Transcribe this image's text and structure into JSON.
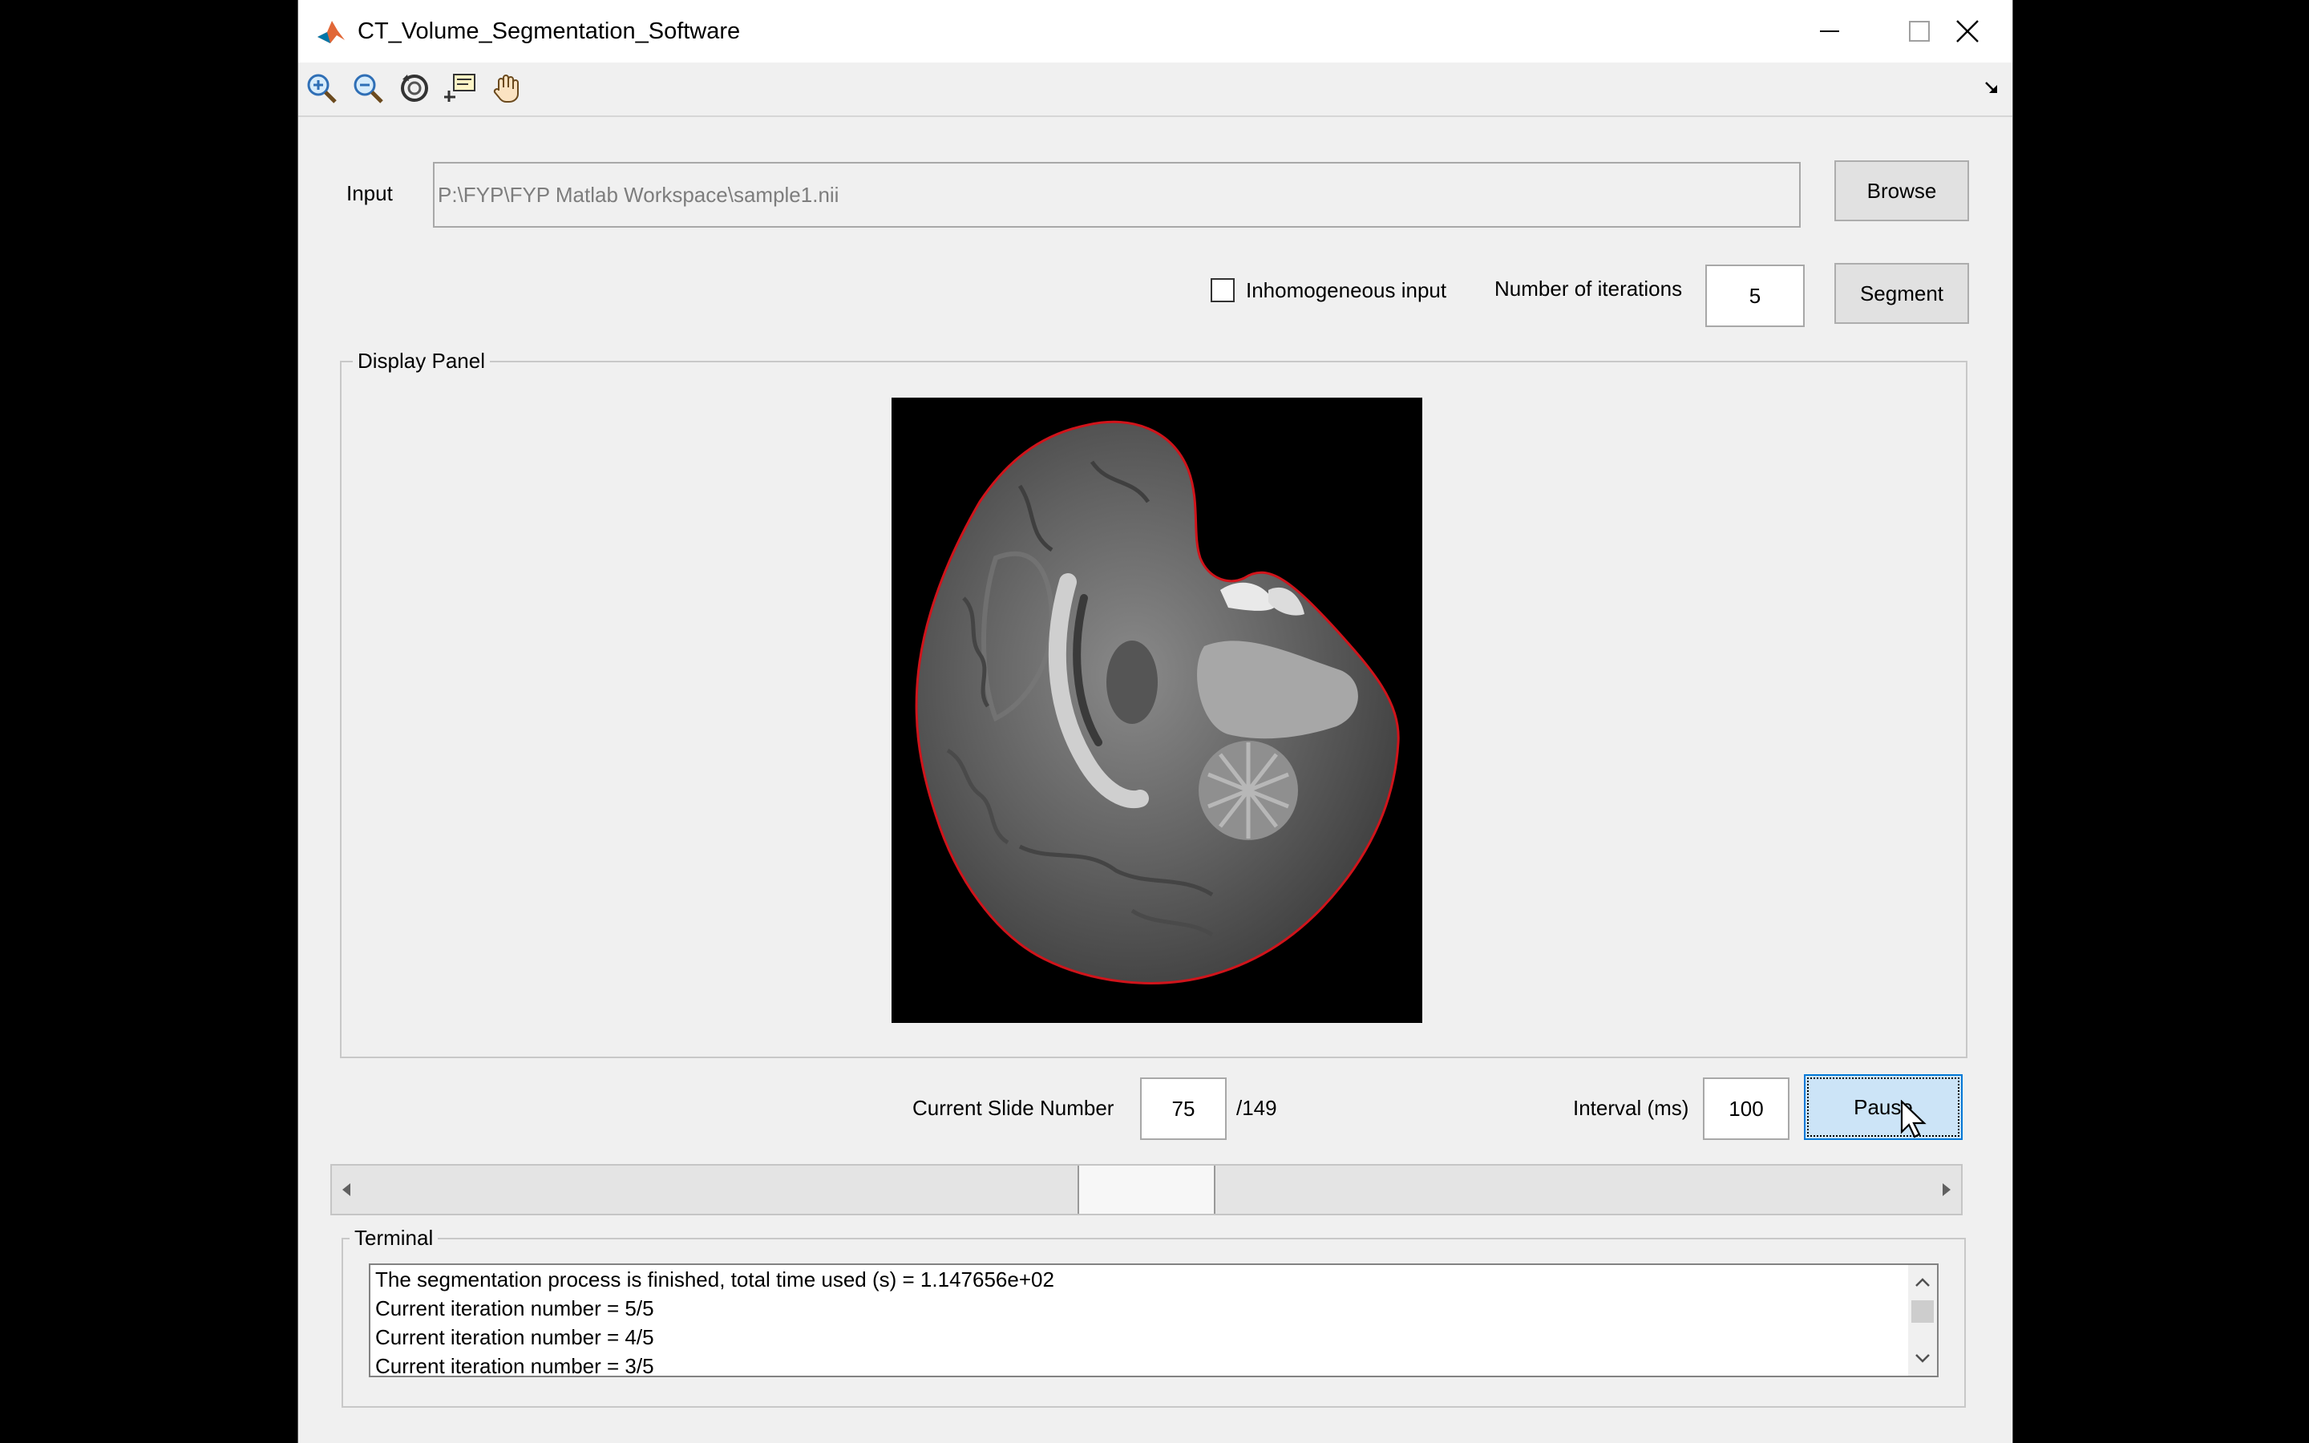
{
  "window": {
    "title": "CT_Volume_Segmentation_Software",
    "icon": "matlab-icon",
    "controls": [
      "minimize-icon",
      "maximize-icon",
      "close-icon"
    ]
  },
  "toolbar": {
    "tools": [
      "zoom-in-icon",
      "zoom-out-icon",
      "rotate-3d-icon",
      "data-cursor-icon",
      "pan-hand-icon"
    ]
  },
  "input": {
    "label": "Input",
    "path": "P:\\FYP\\FYP Matlab Workspace\\sample1.nii",
    "browse_label": "Browse"
  },
  "options": {
    "inhomogeneous_label": "Inhomogeneous input",
    "inhomogeneous_checked": false,
    "iterations_label": "Number of iterations",
    "iterations_value": "5",
    "segment_label": "Segment"
  },
  "display_panel": {
    "title": "Display Panel",
    "image_description": "sagittal brain slice with red segmentation contour",
    "contour_color": "#d0141b"
  },
  "slide": {
    "label": "Current Slide Number",
    "current": "75",
    "total": "/149",
    "value": 75,
    "max": 149
  },
  "interval": {
    "label": "Interval (ms)",
    "value": "100",
    "pause_label": "Pause"
  },
  "terminal": {
    "title": "Terminal",
    "lines": [
      "The segmentation process is finished, total time used (s) = 1.147656e+02",
      "Current iteration number = 5/5",
      "Current iteration number = 4/5",
      "Current iteration number = 3/5"
    ]
  },
  "colors": {
    "accent": "#0078d7",
    "active_button": "#cce4f7",
    "window_bg": "#f0f0f0"
  }
}
